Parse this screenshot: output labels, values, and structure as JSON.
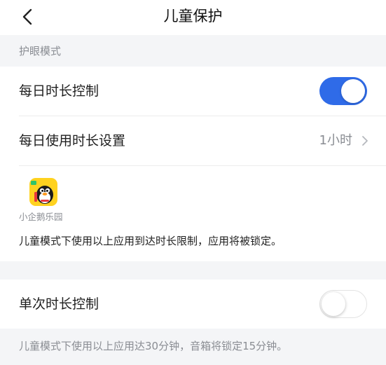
{
  "header": {
    "title": "儿童保护"
  },
  "section": {
    "label": "护眼模式"
  },
  "daily_control": {
    "label": "每日时长控制",
    "enabled": true
  },
  "daily_setting": {
    "label": "每日使用时长设置",
    "value": "1小时"
  },
  "app": {
    "name": "小企鹅乐园"
  },
  "note_daily": "儿童模式下使用以上应用到达时长限制，应用将被锁定。",
  "single_control": {
    "label": "单次时长控制",
    "enabled": false
  },
  "note_single": "儿童模式下使用以上应用达30分钟，音箱将锁定15分钟。",
  "colors": {
    "accent": "#2f6be8",
    "background": "#f4f5f7",
    "secondary_text": "#8a8d93"
  },
  "icons": {
    "back": "chevron-left-icon",
    "forward": "chevron-right-icon",
    "app": "penguin-app-icon"
  }
}
